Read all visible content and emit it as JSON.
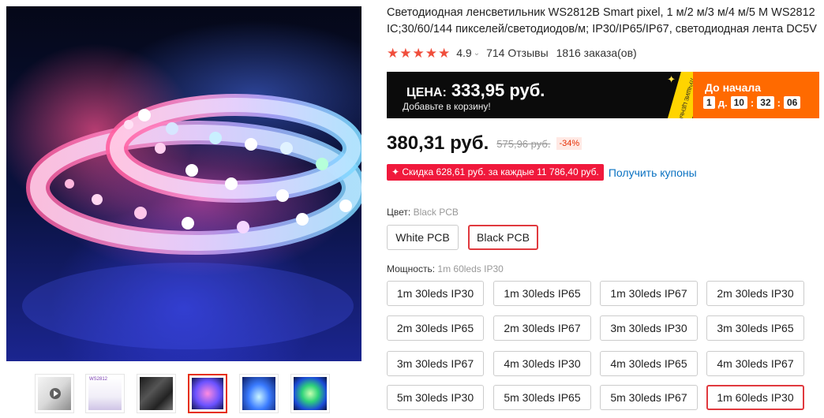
{
  "product": {
    "title": "Светодиодная ленсветильник WS2812B Smart pixel, 1 м/2 м/3 м/4 м/5 М WS2812 IC;30/60/144 пикселей/светодиодов/м; IP30/IP65/IP67, светодиодная лента DC5V",
    "rating": "4.9",
    "reviews": "714 Отзывы",
    "orders": "1816 заказа(ов)"
  },
  "promo": {
    "price_label": "ЦЕНА:",
    "price": "333,95 руб.",
    "subtitle": "Добавьте в корзину!",
    "stripe_text": "ЛУЧШИЕ ЦЕНЫ",
    "countdown_label": "До начала",
    "days": "1",
    "days_label": "д.",
    "hours": "10",
    "minutes": "32",
    "seconds": "06"
  },
  "price": {
    "current": "380,31 руб.",
    "original": "575,96 руб.",
    "discount": "-34%"
  },
  "coupon": {
    "tag": "✦ Скидка 628,61 руб. за каждые 11 786,40 руб.",
    "link": "Получить купоны"
  },
  "color": {
    "label": "Цвет:",
    "selected": "Black PCB",
    "options": [
      "White PCB",
      "Black PCB"
    ]
  },
  "power": {
    "label": "Мощность:",
    "selected": "1m 60leds IP30",
    "options": [
      "1m 30leds IP30",
      "1m 30leds IP65",
      "1m 30leds IP67",
      "2m 30leds IP30",
      "2m 30leds IP65",
      "2m 30leds IP67",
      "3m 30leds IP30",
      "3m 30leds IP65",
      "3m 30leds IP67",
      "4m 30leds IP30",
      "4m 30leds IP65",
      "4m 30leds IP67",
      "5m 30leds IP30",
      "5m 30leds IP65",
      "5m 30leds IP67",
      "1m 60leds IP30"
    ]
  },
  "gallery": {
    "active_index": 3,
    "thumbnails": [
      "thumb-1",
      "thumb-2",
      "thumb-3",
      "thumb-4",
      "thumb-5",
      "thumb-6"
    ],
    "thumb2_text": "WS2812"
  },
  "colors": {
    "star": "#f04e3c",
    "accent_red": "#e62e04",
    "countdown_bg": "#ff6a00",
    "coupon_bg": "#f0193c",
    "link": "#0a72c2"
  }
}
